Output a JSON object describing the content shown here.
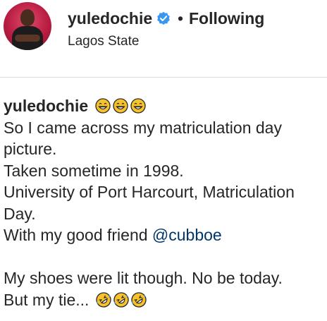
{
  "header": {
    "username": "yuledochie",
    "separator": "•",
    "follow_label": "Following",
    "location": "Lagos State"
  },
  "caption": {
    "username": "yuledochie",
    "title_emojis": [
      "grinning-face-with-smiling-eyes",
      "grinning-face-with-smiling-eyes",
      "grinning-face-with-smiling-eyes"
    ],
    "line1": "So I came across my matriculation day",
    "line2": "picture.",
    "line3": "Taken sometime in 1998.",
    "line4": "University of Port Harcourt, Matriculation",
    "line5": "Day.",
    "line6_prefix": "With my good friend",
    "mention": "@cubboe",
    "line8": "My shoes were lit though. No be today.",
    "line9_prefix": "But my tie...",
    "end_emojis": [
      "rolling-on-floor-laughing",
      "rolling-on-floor-laughing",
      "rolling-on-floor-laughing"
    ]
  },
  "colors": {
    "text": "#262626",
    "verified_blue": "#3897f0",
    "mention": "#00376b",
    "divider": "#dbdbdb",
    "emoji_yellow": "#f7c22c"
  }
}
